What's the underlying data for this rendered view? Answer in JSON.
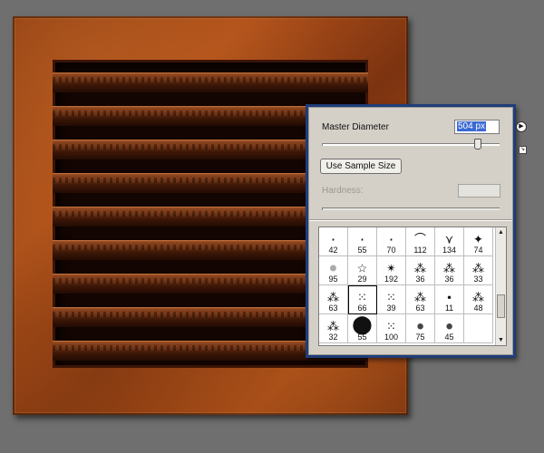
{
  "panel": {
    "master_diameter_label": "Master Diameter",
    "master_diameter_value": "504 px",
    "master_diameter_fraction": 0.88,
    "menu_icon": "flyout-arrow-icon",
    "sample_button_label": "Use Sample Size",
    "hardness_label": "Hardness:",
    "hardness_value": ""
  },
  "brushes": [
    {
      "size": "42",
      "icon": "soft-dot-icon"
    },
    {
      "size": "55",
      "icon": "soft-dot-icon"
    },
    {
      "size": "70",
      "icon": "soft-dot-icon"
    },
    {
      "size": "112",
      "icon": "grass-stroke-icon"
    },
    {
      "size": "134",
      "icon": "grass-blades-icon"
    },
    {
      "size": "74",
      "icon": "maple-leaf-icon"
    },
    {
      "size": "95",
      "icon": "fuzzy-ball-icon"
    },
    {
      "size": "29",
      "icon": "star-outline-icon"
    },
    {
      "size": "192",
      "icon": "scatter-star-icon"
    },
    {
      "size": "36",
      "icon": "texture-icon"
    },
    {
      "size": "36",
      "icon": "texture-icon"
    },
    {
      "size": "33",
      "icon": "texture-icon"
    },
    {
      "size": "63",
      "icon": "texture-icon"
    },
    {
      "size": "66",
      "icon": "spray-icon"
    },
    {
      "size": "39",
      "icon": "spray-icon"
    },
    {
      "size": "63",
      "icon": "texture-icon"
    },
    {
      "size": "11",
      "icon": "hard-dot-icon"
    },
    {
      "size": "48",
      "icon": "texture-icon"
    },
    {
      "size": "32",
      "icon": "texture-icon"
    },
    {
      "size": "55",
      "icon": "hard-round-icon"
    },
    {
      "size": "100",
      "icon": "spray-icon"
    },
    {
      "size": "75",
      "icon": "soft-round-icon"
    },
    {
      "size": "45",
      "icon": "soft-round-icon"
    },
    {
      "size": "",
      "icon": ""
    }
  ],
  "selected_brush_index": 13
}
